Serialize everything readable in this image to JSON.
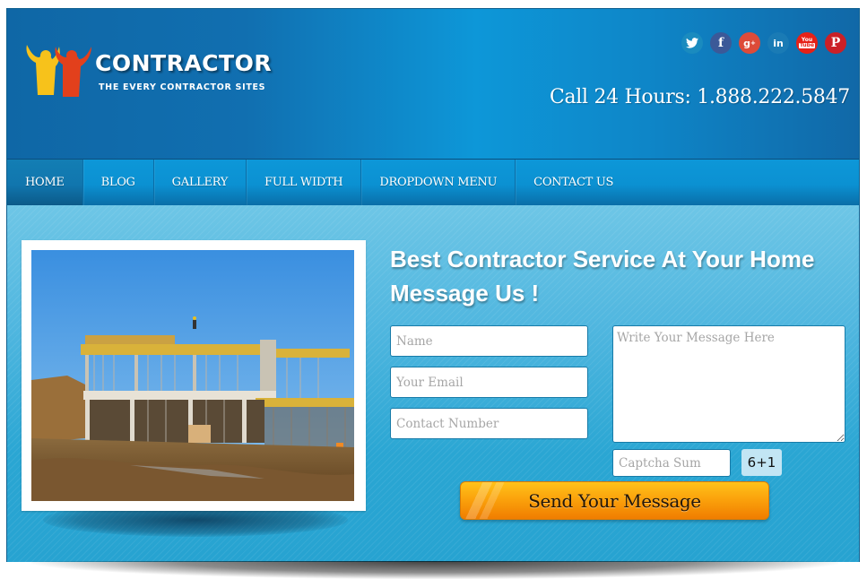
{
  "header": {
    "logo_title": "CONTRACTOR",
    "logo_tagline": "THE EVERY CONTRACTOR  SITES",
    "phone": "Call 24 Hours: 1.888.222.5847",
    "social": [
      {
        "name": "twitter",
        "glyph": "🐦",
        "color": "#1a8bbf"
      },
      {
        "name": "facebook",
        "glyph": "f",
        "color": "#3b5998"
      },
      {
        "name": "google-plus",
        "glyph": "g+",
        "color": "#dd4b39"
      },
      {
        "name": "linkedin",
        "glyph": "in",
        "color": "#1a7bb5"
      },
      {
        "name": "youtube",
        "glyph": "You",
        "color": "#e62117"
      },
      {
        "name": "pinterest",
        "glyph": "P",
        "color": "#cb2027"
      }
    ]
  },
  "nav": {
    "items": [
      {
        "label": "HOME",
        "active": true
      },
      {
        "label": "BLOG",
        "active": false
      },
      {
        "label": "GALLERY",
        "active": false
      },
      {
        "label": "FULL WIDTH",
        "active": false
      },
      {
        "label": "DROPDOWN MENU",
        "active": false
      },
      {
        "label": "CONTACT US",
        "active": false
      }
    ]
  },
  "main": {
    "heading_line1": "Best Contractor Service At Your Home",
    "heading_line2": "Message Us !",
    "form": {
      "name_placeholder": "Name",
      "email_placeholder": "Your Email",
      "contact_placeholder": "Contact Number",
      "message_placeholder": "Write Your Message Here",
      "captcha_placeholder": "Captcha Sum",
      "captcha_question": "6+1",
      "send_label": "Send Your Message"
    },
    "photo_alt": "Building under construction"
  },
  "colors": {
    "header_blue": "#0d97d8",
    "nav_active": "#1176ae",
    "button_orange": "#fba30c"
  }
}
